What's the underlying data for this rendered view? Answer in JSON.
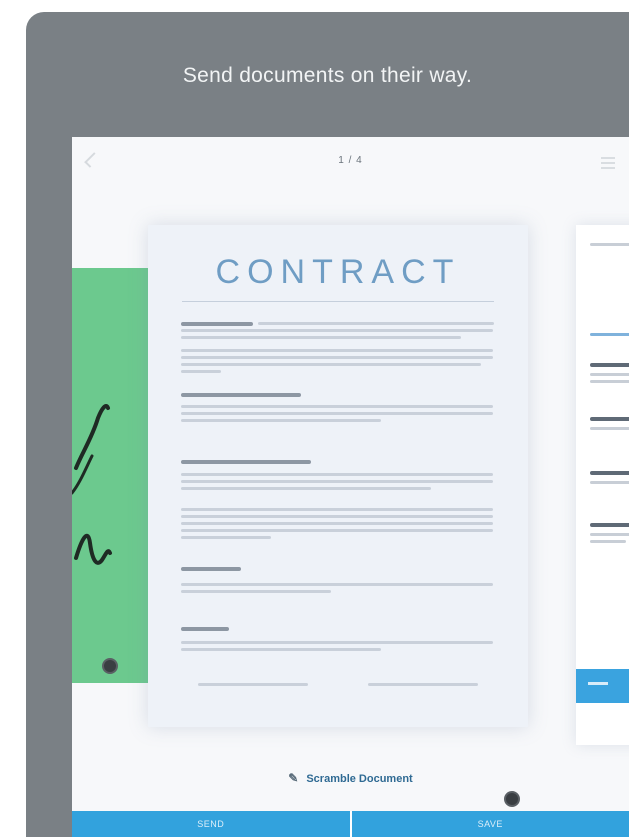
{
  "headline": "Send documents on their way.",
  "topbar": {
    "page_indicator": "1 / 4",
    "back_icon": "chevron-left-icon",
    "menu_icon": "menu-icon"
  },
  "document": {
    "title": "CONTRACT"
  },
  "scramble": {
    "icon": "pencil-icon",
    "label": "Scramble Document"
  },
  "bottom_bar": {
    "left_label": "SEND",
    "right_label": "SAVE"
  },
  "colors": {
    "frame": "#7a8085",
    "accent": "#32a2dd",
    "green_page": "#6cc98e",
    "contract_title": "#6f9dc4"
  }
}
